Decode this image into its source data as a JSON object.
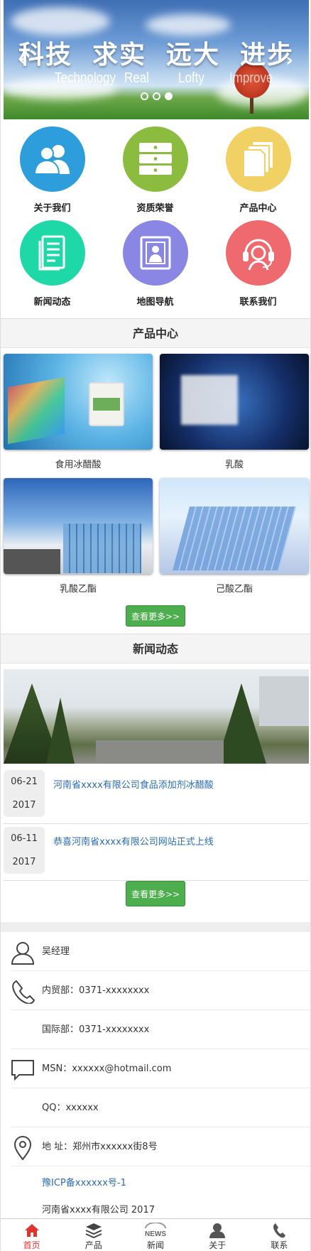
{
  "banner": {
    "slogan": [
      "科技",
      "求实",
      "远大",
      "进步"
    ],
    "sub": [
      "Technology",
      "Real",
      "Lofty",
      "Improve"
    ],
    "prev_icon": "chevron-left-icon",
    "next_icon": "chevron-right-icon",
    "active_dot": 3
  },
  "grid": [
    {
      "label": "关于我们",
      "icon": "users-icon",
      "color": "#2e9ddc"
    },
    {
      "label": "资质荣誉",
      "icon": "drawers-icon",
      "color": "#8cbc3f"
    },
    {
      "label": "产品中心",
      "icon": "files-icon",
      "color": "#f1d064"
    },
    {
      "label": "新闻动态",
      "icon": "document-icon",
      "color": "#1fd8a8"
    },
    {
      "label": "地图导航",
      "icon": "person-card-icon",
      "color": "#8a86e4"
    },
    {
      "label": "联系我们",
      "icon": "headset-icon",
      "color": "#ef6a6f"
    }
  ],
  "products": {
    "heading": "产品中心",
    "items": [
      {
        "name": "食用冰醋酸"
      },
      {
        "name": "乳酸"
      },
      {
        "name": "乳酸乙酯"
      },
      {
        "name": "己酸乙酯"
      }
    ],
    "more_label": "查看更多>>"
  },
  "news": {
    "heading": "新闻动态",
    "items": [
      {
        "day": "06-21",
        "year": "2017",
        "title": "河南省xxxx有限公司食品添加剂冰醋酸"
      },
      {
        "day": "06-11",
        "year": "2017",
        "title": "恭喜河南省xxxx有限公司网站正式上线"
      }
    ],
    "more_label": "查看更多>>"
  },
  "contact": {
    "person": "吴经理",
    "phone1": "内贸部：0371-xxxxxxxx",
    "phone2": "国际部：0371-xxxxxxxx",
    "msn": "MSN：xxxxxx@hotmail.com",
    "qq": "QQ：xxxxxx",
    "address": "地 址：郑州市xxxxxx街8号",
    "icp": "豫ICP备xxxxxx号-1",
    "copyright": "河南省xxxx有限公司 2017"
  },
  "bottom_nav": [
    {
      "label": "首页",
      "icon": "home-icon",
      "active": true
    },
    {
      "label": "产品",
      "icon": "layers-icon",
      "active": false
    },
    {
      "label": "新闻",
      "icon": "news-icon",
      "active": false
    },
    {
      "label": "关于",
      "icon": "user-icon",
      "active": false
    },
    {
      "label": "联系",
      "icon": "phone-icon",
      "active": false
    }
  ],
  "colors": {
    "accent": "#4cae4c",
    "link": "#2a6cb5",
    "nav_active": "#e3322d"
  }
}
